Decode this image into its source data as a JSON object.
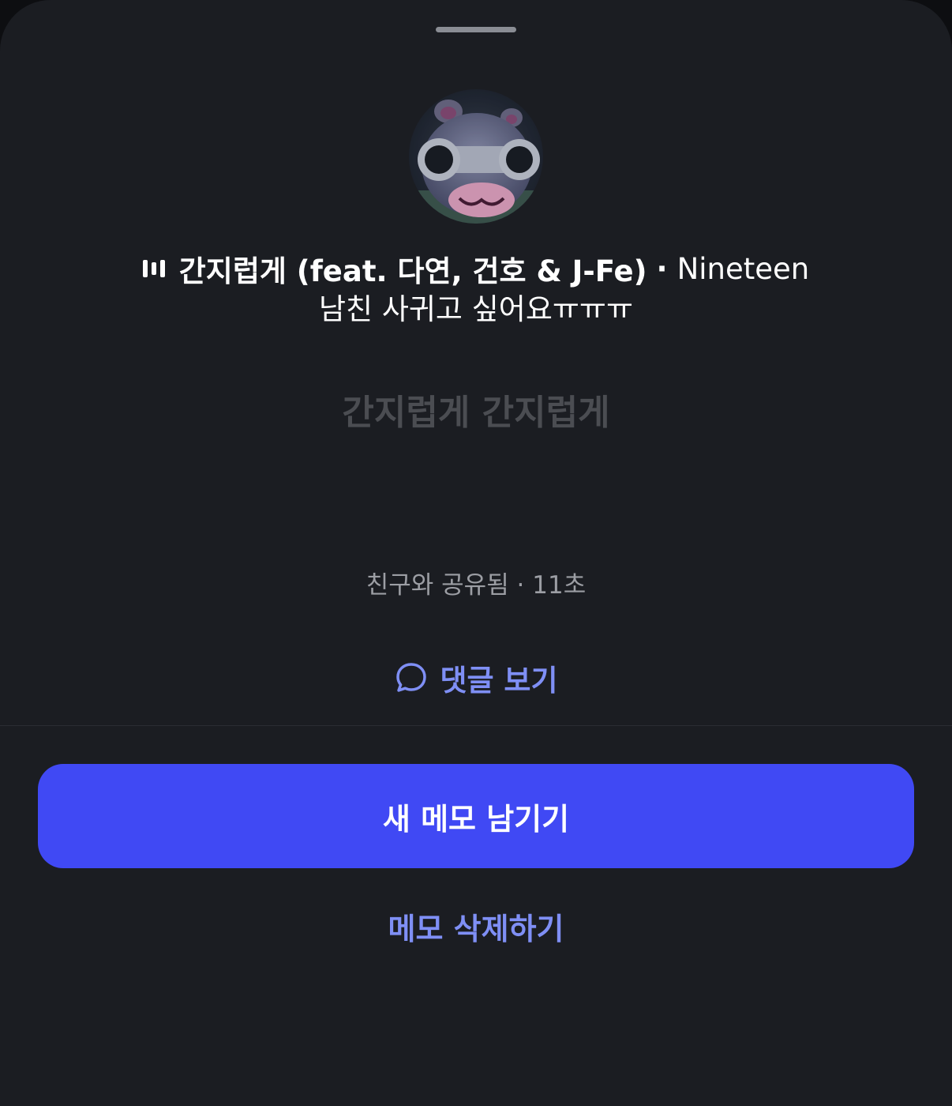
{
  "note": {
    "avatar_icon": "avatar-icon",
    "song": {
      "playing_icon": "equalizer-icon",
      "title": "간지럽게 (feat. 다연, 건호 & J-Fe)",
      "separator": "·",
      "artist": "Nineteen"
    },
    "memo_text": "남친 사귀고 싶어요ㅠㅠㅠ",
    "lyric": "간지럽게 간지럽게",
    "shared_meta": "친구와 공유됨 · 11초"
  },
  "actions": {
    "comments_icon": "speech-bubble-icon",
    "comments_label": "댓글 보기",
    "new_memo_label": "새 메모 남기기",
    "delete_memo_label": "메모 삭제하기"
  },
  "colors": {
    "sheet_background": "#1b1d22",
    "primary_button": "#4049f4",
    "link_accent": "#7f8ff5",
    "muted_text": "#9c9ea4",
    "faded_lyric": "#4b4d52"
  }
}
